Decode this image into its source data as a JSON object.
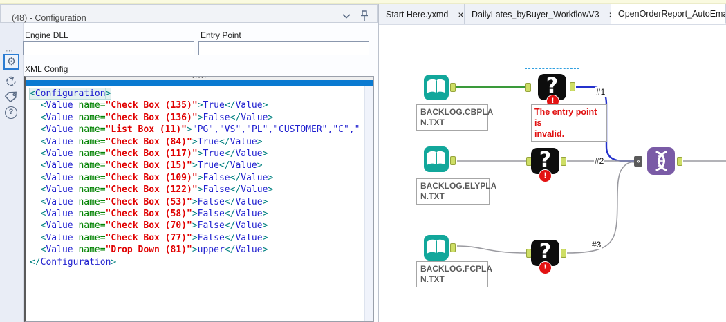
{
  "panel": {
    "title": "(48) - Configuration",
    "fields": {
      "engine_dll": {
        "label": "Engine DLL",
        "value": ""
      },
      "entry_point": {
        "label": "Entry Point",
        "value": ""
      }
    },
    "xml_label": "XML Config",
    "sidebar_glyphs": {
      "dots": "⋯",
      "gear": "⚙",
      "help": "?"
    }
  },
  "xml_lines": [
    [
      [
        "b",
        "<"
      ],
      [
        "t",
        "Configuration"
      ],
      [
        "b",
        ">"
      ]
    ],
    [
      [
        "w",
        "  "
      ],
      [
        "b",
        "<"
      ],
      [
        "t",
        "Value"
      ],
      [
        "w",
        " "
      ],
      [
        "a",
        "name="
      ],
      [
        "v",
        "\"Check Box (135)\""
      ],
      [
        "b",
        ">"
      ],
      [
        "x",
        "True"
      ],
      [
        "b",
        "</"
      ],
      [
        "t",
        "Value"
      ],
      [
        "b",
        ">"
      ]
    ],
    [
      [
        "w",
        "  "
      ],
      [
        "b",
        "<"
      ],
      [
        "t",
        "Value"
      ],
      [
        "w",
        " "
      ],
      [
        "a",
        "name="
      ],
      [
        "v",
        "\"Check Box (136)\""
      ],
      [
        "b",
        ">"
      ],
      [
        "x",
        "False"
      ],
      [
        "b",
        "</"
      ],
      [
        "t",
        "Value"
      ],
      [
        "b",
        ">"
      ]
    ],
    [
      [
        "w",
        "  "
      ],
      [
        "b",
        "<"
      ],
      [
        "t",
        "Value"
      ],
      [
        "w",
        " "
      ],
      [
        "a",
        "name="
      ],
      [
        "v",
        "\"List Box (11)\""
      ],
      [
        "b",
        ">"
      ],
      [
        "x",
        "\"PG\",\"VS\",\"PL\",\"CUSTOMER\",\"C\",\""
      ]
    ],
    [
      [
        "w",
        "  "
      ],
      [
        "b",
        "<"
      ],
      [
        "t",
        "Value"
      ],
      [
        "w",
        " "
      ],
      [
        "a",
        "name="
      ],
      [
        "v",
        "\"Check Box (84)\""
      ],
      [
        "b",
        ">"
      ],
      [
        "x",
        "True"
      ],
      [
        "b",
        "</"
      ],
      [
        "t",
        "Value"
      ],
      [
        "b",
        ">"
      ]
    ],
    [
      [
        "w",
        "  "
      ],
      [
        "b",
        "<"
      ],
      [
        "t",
        "Value"
      ],
      [
        "w",
        " "
      ],
      [
        "a",
        "name="
      ],
      [
        "v",
        "\"Check Box (117)\""
      ],
      [
        "b",
        ">"
      ],
      [
        "x",
        "True"
      ],
      [
        "b",
        "</"
      ],
      [
        "t",
        "Value"
      ],
      [
        "b",
        ">"
      ]
    ],
    [
      [
        "w",
        "  "
      ],
      [
        "b",
        "<"
      ],
      [
        "t",
        "Value"
      ],
      [
        "w",
        " "
      ],
      [
        "a",
        "name="
      ],
      [
        "v",
        "\"Check Box (15)\""
      ],
      [
        "b",
        ">"
      ],
      [
        "x",
        "True"
      ],
      [
        "b",
        "</"
      ],
      [
        "t",
        "Value"
      ],
      [
        "b",
        ">"
      ]
    ],
    [
      [
        "w",
        "  "
      ],
      [
        "b",
        "<"
      ],
      [
        "t",
        "Value"
      ],
      [
        "w",
        " "
      ],
      [
        "a",
        "name="
      ],
      [
        "v",
        "\"Check Box (109)\""
      ],
      [
        "b",
        ">"
      ],
      [
        "x",
        "False"
      ],
      [
        "b",
        "</"
      ],
      [
        "t",
        "Value"
      ],
      [
        "b",
        ">"
      ]
    ],
    [
      [
        "w",
        "  "
      ],
      [
        "b",
        "<"
      ],
      [
        "t",
        "Value"
      ],
      [
        "w",
        " "
      ],
      [
        "a",
        "name="
      ],
      [
        "v",
        "\"Check Box (122)\""
      ],
      [
        "b",
        ">"
      ],
      [
        "x",
        "False"
      ],
      [
        "b",
        "</"
      ],
      [
        "t",
        "Value"
      ],
      [
        "b",
        ">"
      ]
    ],
    [
      [
        "w",
        "  "
      ],
      [
        "b",
        "<"
      ],
      [
        "t",
        "Value"
      ],
      [
        "w",
        " "
      ],
      [
        "a",
        "name="
      ],
      [
        "v",
        "\"Check Box (53)\""
      ],
      [
        "b",
        ">"
      ],
      [
        "x",
        "False"
      ],
      [
        "b",
        "</"
      ],
      [
        "t",
        "Value"
      ],
      [
        "b",
        ">"
      ]
    ],
    [
      [
        "w",
        "  "
      ],
      [
        "b",
        "<"
      ],
      [
        "t",
        "Value"
      ],
      [
        "w",
        " "
      ],
      [
        "a",
        "name="
      ],
      [
        "v",
        "\"Check Box (58)\""
      ],
      [
        "b",
        ">"
      ],
      [
        "x",
        "False"
      ],
      [
        "b",
        "</"
      ],
      [
        "t",
        "Value"
      ],
      [
        "b",
        ">"
      ]
    ],
    [
      [
        "w",
        "  "
      ],
      [
        "b",
        "<"
      ],
      [
        "t",
        "Value"
      ],
      [
        "w",
        " "
      ],
      [
        "a",
        "name="
      ],
      [
        "v",
        "\"Check Box (70)\""
      ],
      [
        "b",
        ">"
      ],
      [
        "x",
        "False"
      ],
      [
        "b",
        "</"
      ],
      [
        "t",
        "Value"
      ],
      [
        "b",
        ">"
      ]
    ],
    [
      [
        "w",
        "  "
      ],
      [
        "b",
        "<"
      ],
      [
        "t",
        "Value"
      ],
      [
        "w",
        " "
      ],
      [
        "a",
        "name="
      ],
      [
        "v",
        "\"Check Box (77)\""
      ],
      [
        "b",
        ">"
      ],
      [
        "x",
        "False"
      ],
      [
        "b",
        "</"
      ],
      [
        "t",
        "Value"
      ],
      [
        "b",
        ">"
      ]
    ],
    [
      [
        "w",
        "  "
      ],
      [
        "b",
        "<"
      ],
      [
        "t",
        "Value"
      ],
      [
        "w",
        " "
      ],
      [
        "a",
        "name="
      ],
      [
        "v",
        "\"Drop Down (81)\""
      ],
      [
        "b",
        ">"
      ],
      [
        "x",
        "upper"
      ],
      [
        "b",
        "</"
      ],
      [
        "t",
        "Value"
      ],
      [
        "b",
        ">"
      ]
    ],
    [
      [
        "b",
        "</"
      ],
      [
        "t",
        "Configuration"
      ],
      [
        "b",
        ">"
      ]
    ]
  ],
  "tabs": [
    {
      "label": "Start Here.yxmd",
      "close": "×"
    },
    {
      "label": "DailyLates_byBuyer_WorkflowV3",
      "close": "×"
    },
    {
      "label": "OpenOrderReport_AutoEmail.",
      "close": ""
    }
  ],
  "canvas": {
    "question_glyph": "?",
    "error_glyph": "!",
    "multi_input_glyph": "»",
    "rows": [
      {
        "file_lines": [
          "BACKLOG.CBPLA",
          "N.TXT"
        ],
        "wire_label": "#1"
      },
      {
        "file_lines": [
          "BACKLOG.ELYPLA",
          "N.TXT"
        ],
        "wire_label": "#2"
      },
      {
        "file_lines": [
          "BACKLOG.FCPLA",
          "N.TXT"
        ],
        "wire_label": "#3"
      }
    ],
    "error_tooltip_lines": [
      "The entry point is",
      "invalid."
    ]
  },
  "colors": {
    "splitter_blue": "#0a7ad1",
    "xml_tag_blue": "#2020cf",
    "xml_bracket_teal": "#00807f",
    "xml_attr_green": "#008200",
    "xml_value_red": "#e00000",
    "input_tool_teal": "#12a79b",
    "unknown_tool_black": "#0d0d0d",
    "union_tool_purple": "#7a5ba6",
    "anchor_green": "#cede66",
    "wire_selected_green": "#3a9a3a",
    "wire_selected_blue": "#2431cc",
    "wire_gray": "#9a9aa0",
    "error_red": "#e01010",
    "selection_dash_blue": "#2f9fe0"
  }
}
